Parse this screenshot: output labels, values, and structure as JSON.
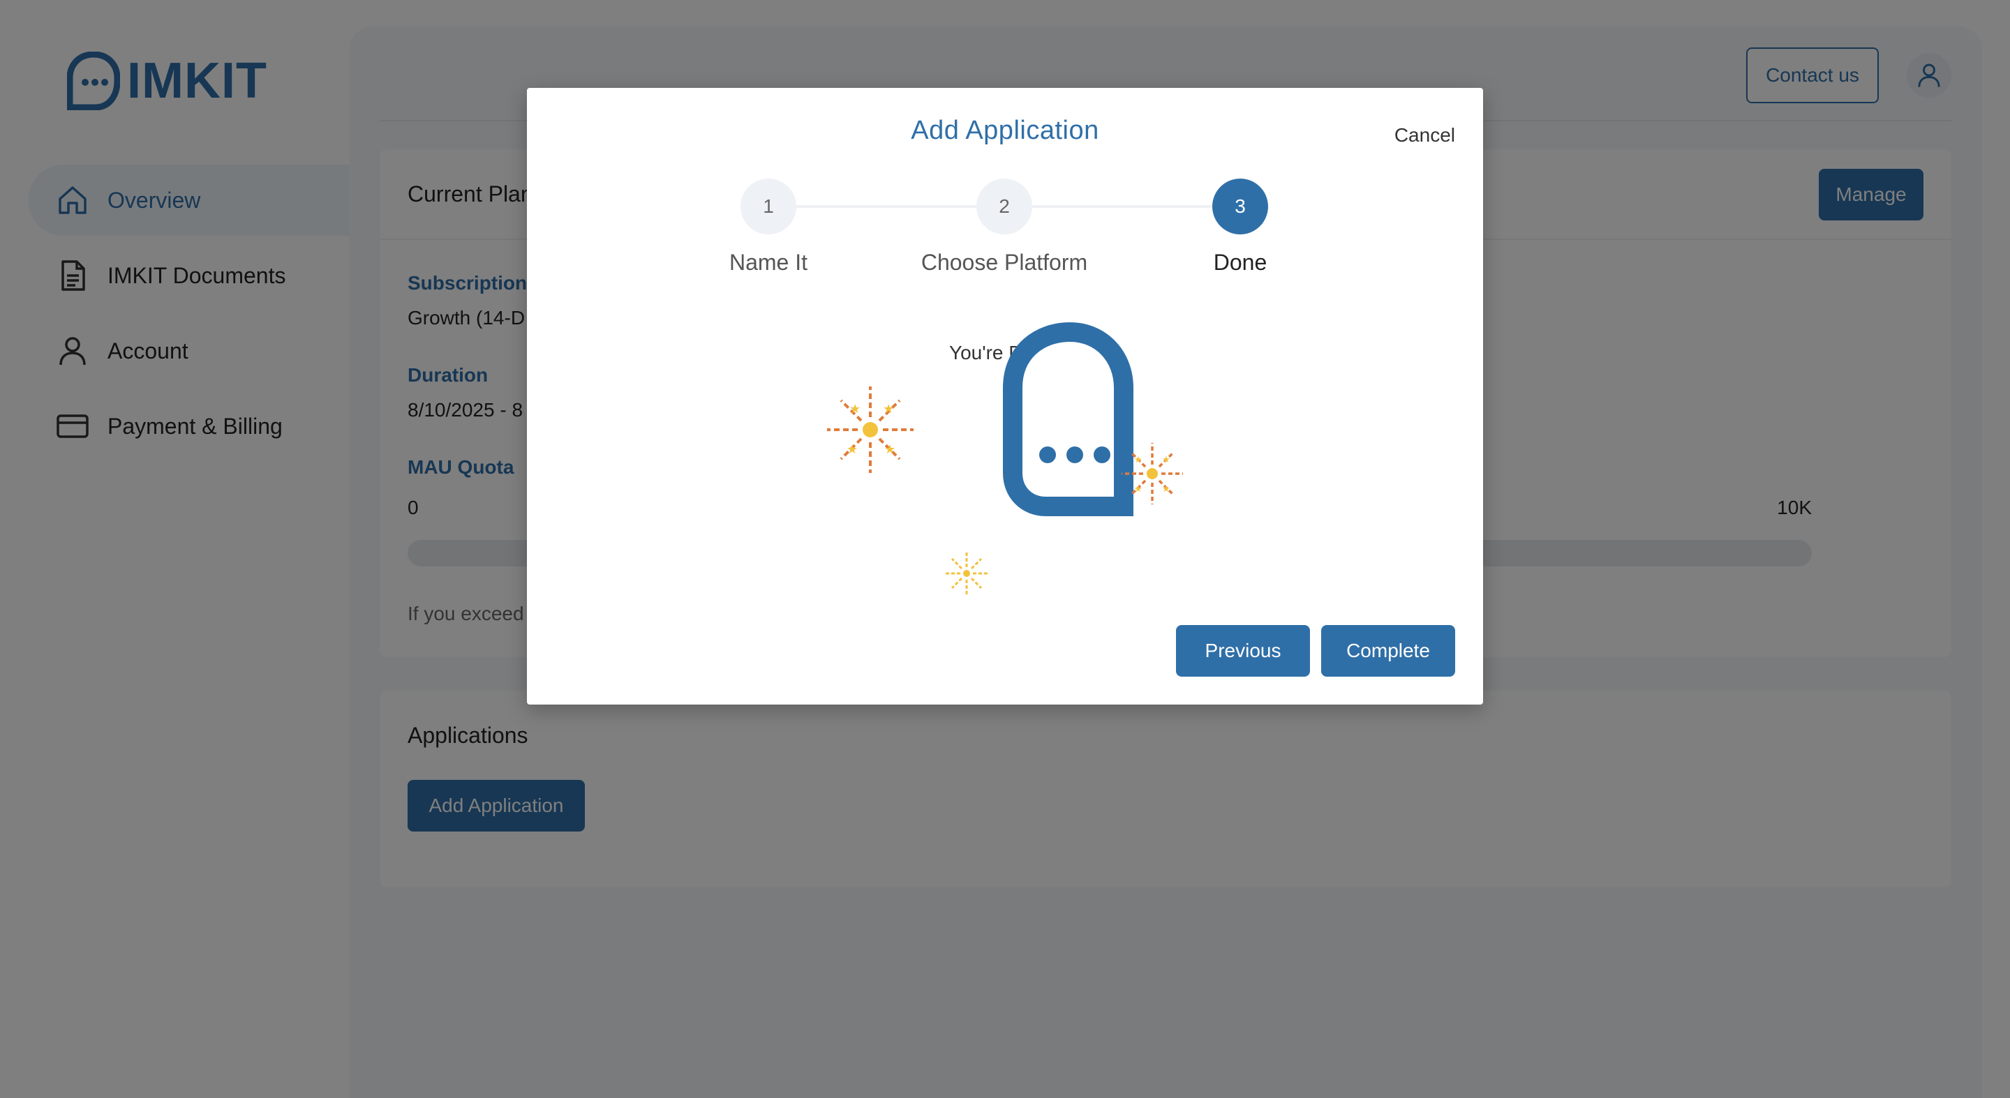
{
  "brand": {
    "name": "IMKIT",
    "color": "#2f6fa8"
  },
  "sidebar": {
    "items": [
      {
        "label": "Overview",
        "icon": "home-icon",
        "active": true
      },
      {
        "label": "IMKIT Documents",
        "icon": "document-icon",
        "active": false
      },
      {
        "label": "Account",
        "icon": "user-icon",
        "active": false
      },
      {
        "label": "Payment & Billing",
        "icon": "credit-card-icon",
        "active": false
      }
    ]
  },
  "header": {
    "contact_label": "Contact us",
    "user_icon": "user-icon"
  },
  "plan": {
    "title": "Current Plan",
    "manage_label": "Manage",
    "subscription_label": "Subscription",
    "subscription_value": "Growth (14-D",
    "duration_label": "Duration",
    "duration_value": "8/10/2025 - 8",
    "quota_label": "MAU Quota",
    "quota_min": "0",
    "quota_max": "10K",
    "quota_used_fraction": 0.0,
    "note": "If you exceed"
  },
  "applications": {
    "title": "Applications",
    "add_label": "Add Application"
  },
  "modal": {
    "title": "Add Application",
    "cancel_label": "Cancel",
    "steps": [
      {
        "number": "1",
        "label": "Name It"
      },
      {
        "number": "2",
        "label": "Choose Platform"
      },
      {
        "number": "3",
        "label": "Done"
      }
    ],
    "active_step": 3,
    "done_message": "You're Done!",
    "previous_label": "Previous",
    "complete_label": "Complete"
  },
  "colors": {
    "accent": "#2f6fa8",
    "firework_orange": "#e07b39",
    "firework_yellow": "#f2c23c"
  }
}
